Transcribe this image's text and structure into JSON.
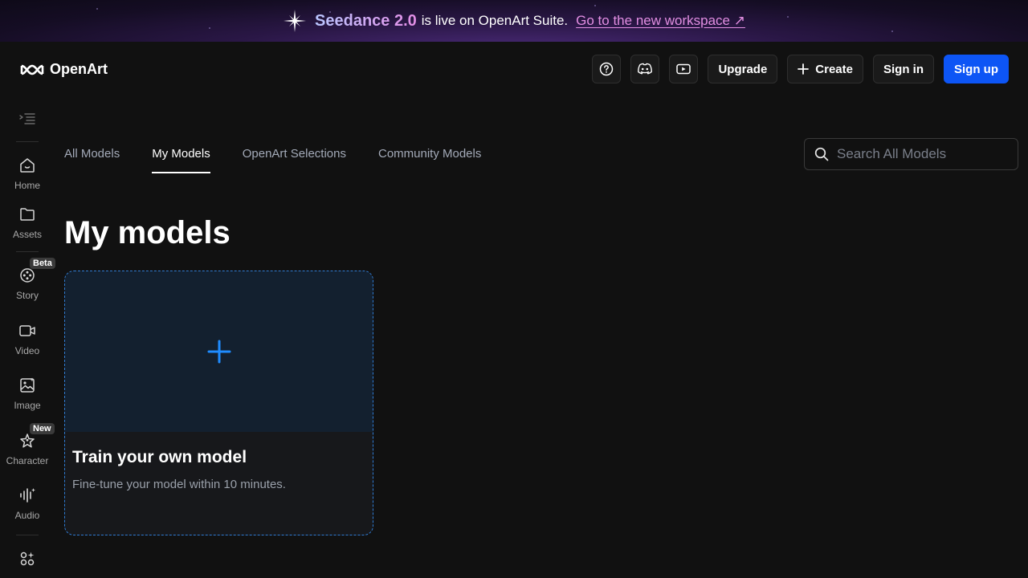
{
  "banner": {
    "brand": "Seedance 2.0",
    "text": "is live on OpenArt Suite.",
    "link": "Go to the new workspace ↗"
  },
  "header": {
    "logo_text": "OpenArt",
    "help_icon": "help-circle-icon",
    "discord_icon": "discord-icon",
    "youtube_icon": "youtube-icon",
    "upgrade_label": "Upgrade",
    "create_label": "Create",
    "signin_label": "Sign in",
    "signup_label": "Sign up"
  },
  "sidebar": {
    "items": [
      {
        "label": "Home",
        "icon": "home-icon"
      },
      {
        "label": "Assets",
        "icon": "folder-icon"
      },
      {
        "label": "Story",
        "icon": "film-reel-icon",
        "badge": "Beta"
      },
      {
        "label": "Video",
        "icon": "video-camera-icon"
      },
      {
        "label": "Image",
        "icon": "image-icon"
      },
      {
        "label": "Character",
        "icon": "character-star-icon",
        "badge": "New"
      },
      {
        "label": "Audio",
        "icon": "audio-wave-icon"
      }
    ]
  },
  "tabs": [
    {
      "label": "All Models",
      "active": false
    },
    {
      "label": "My Models",
      "active": true
    },
    {
      "label": "OpenArt Selections",
      "active": false
    },
    {
      "label": "Community Models",
      "active": false
    }
  ],
  "search": {
    "placeholder": "Search All Models"
  },
  "page": {
    "title": "My models"
  },
  "card": {
    "title": "Train your own model",
    "description": "Fine-tune your model within 10 minutes."
  },
  "colors": {
    "background": "#111111",
    "accent": "#0d55f5",
    "card_border": "#2f7cd4",
    "plus_icon": "#1f8cff"
  }
}
